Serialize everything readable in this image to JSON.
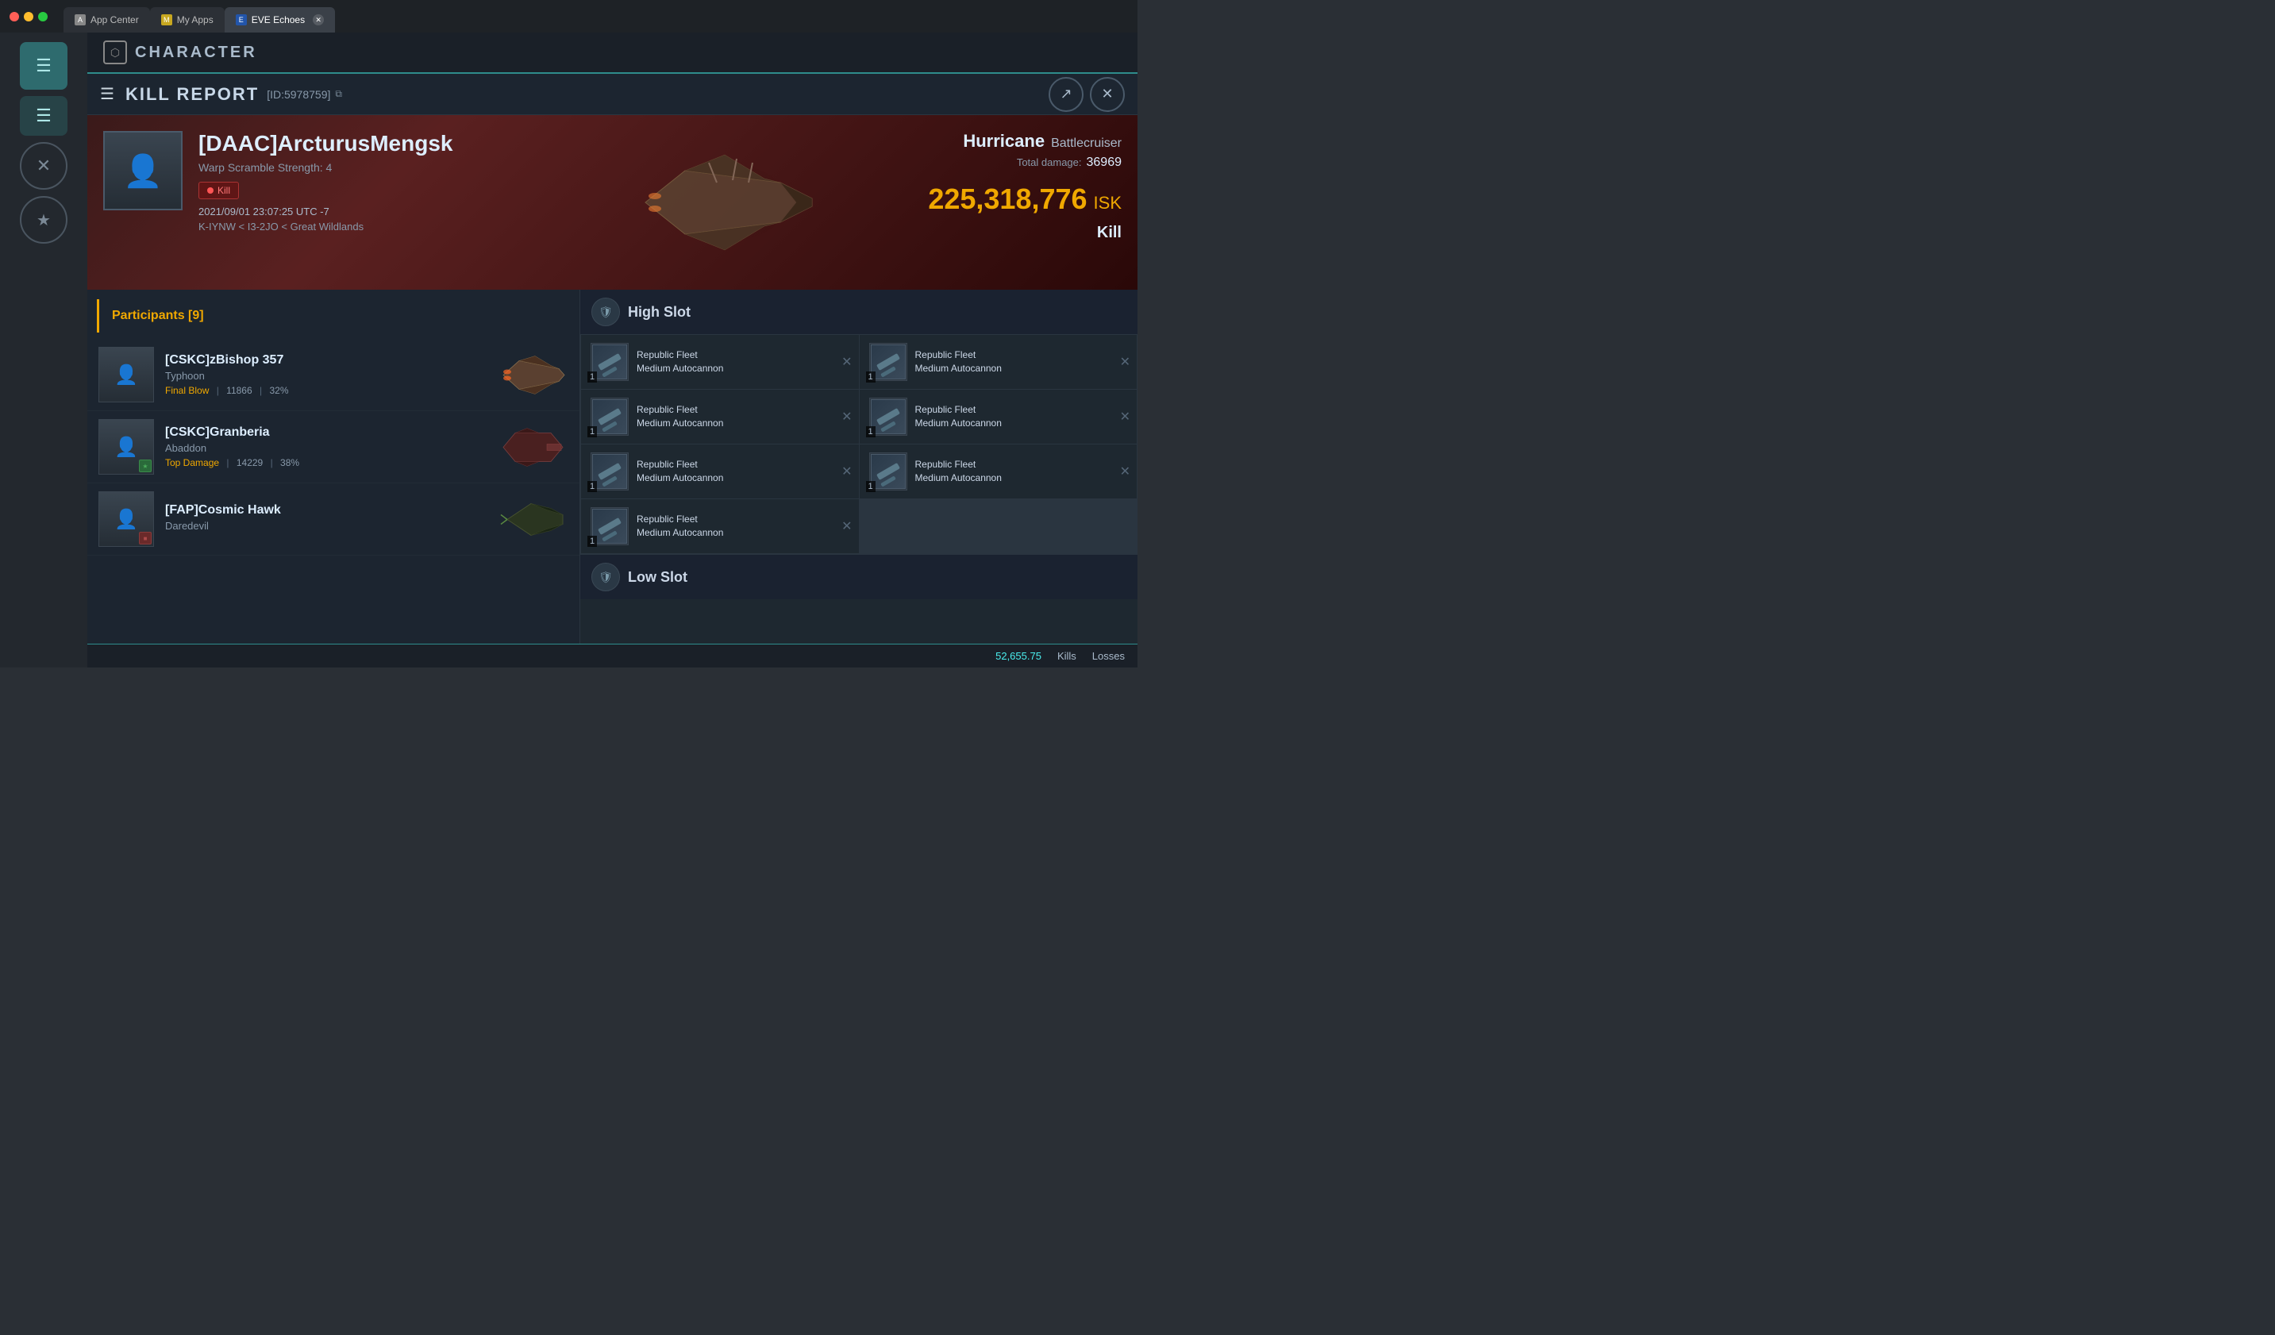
{
  "browser": {
    "tabs": [
      {
        "id": "app-center",
        "label": "App Center",
        "active": false
      },
      {
        "id": "my-apps",
        "label": "My Apps",
        "active": false
      },
      {
        "id": "eve-echoes",
        "label": "EVE Echoes",
        "active": true,
        "closeable": true
      }
    ]
  },
  "character": {
    "title": "CHARACTER"
  },
  "kill_report": {
    "header_title": "KILL REPORT",
    "report_id": "[ID:5978759]",
    "copy_icon": "⧉",
    "pilot_name": "[DAAC]ArcturusMengsk",
    "warp_scramble": "Warp Scramble Strength: 4",
    "kill_label": "Kill",
    "timestamp": "2021/09/01 23:07:25 UTC -7",
    "location": "K-IYNW < I3-2JO < Great Wildlands",
    "ship_name": "Hurricane",
    "ship_type": "Battlecruiser",
    "total_damage_label": "Total damage:",
    "total_damage": "36969",
    "isk_value": "225,318,776",
    "isk_label": "ISK",
    "outcome": "Kill",
    "participants_label": "Participants",
    "participants_count": "9"
  },
  "participants": [
    {
      "name": "[CSKC]zBishop 357",
      "ship": "Typhoon",
      "stat_label": "Final Blow",
      "damage": "11866",
      "percent": "32%",
      "has_corp_badge": true,
      "corp_badge_type": "star"
    },
    {
      "name": "[CSKC]Granberia",
      "ship": "Abaddon",
      "stat_label": "Top Damage",
      "damage": "14229",
      "percent": "38%",
      "has_corp_badge": true,
      "corp_badge_type": "green"
    },
    {
      "name": "[FAP]Cosmic Hawk",
      "ship": "Daredevil",
      "stat_label": "",
      "damage": "",
      "percent": "",
      "has_corp_badge": true,
      "corp_badge_type": "red"
    }
  ],
  "high_slots": {
    "label": "High Slot",
    "items": [
      {
        "name": "Republic Fleet\nMedium Autocannon",
        "qty": "1"
      },
      {
        "name": "Republic Fleet\nMedium Autocannon",
        "qty": "1"
      },
      {
        "name": "Republic Fleet\nMedium Autocannon",
        "qty": "1"
      },
      {
        "name": "Republic Fleet\nMedium Autocannon",
        "qty": "1"
      },
      {
        "name": "Republic Fleet\nMedium Autocannon",
        "qty": "1"
      },
      {
        "name": "Republic Fleet\nMedium Autocannon",
        "qty": "1"
      },
      {
        "name": "Republic Fleet\nMedium Autocannon",
        "qty": "1"
      }
    ]
  },
  "low_slots": {
    "label": "Low Slot"
  },
  "bottom_bar": {
    "amount": "52,655.75",
    "kills_label": "Kills",
    "losses_label": "Losses"
  }
}
